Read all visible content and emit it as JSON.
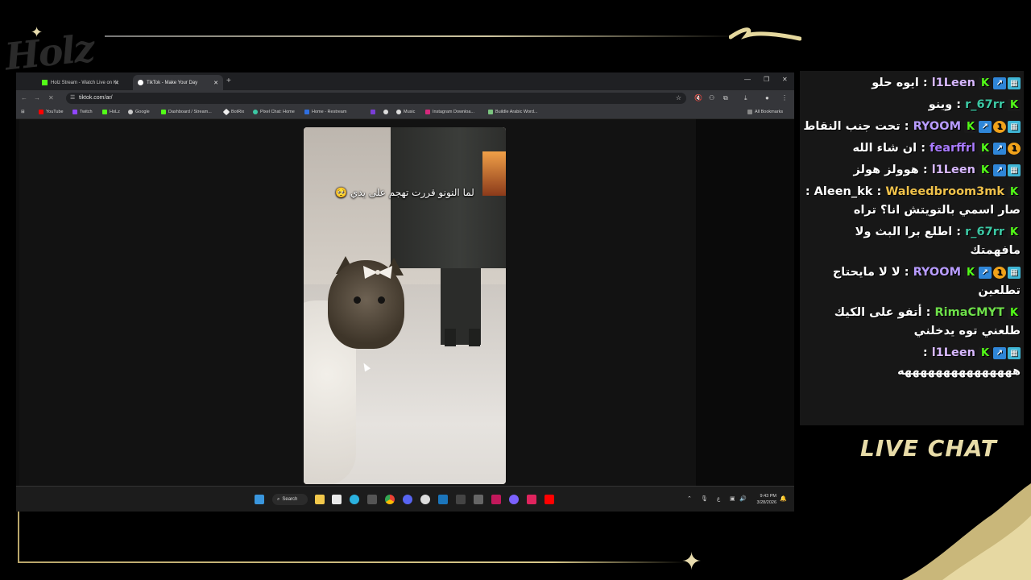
{
  "colors": {
    "gold": "#d8c88a",
    "kick_green": "#53fc18"
  },
  "overlay": {
    "logo_text": "Holz",
    "live_chat_label": "LIVE CHAT"
  },
  "browser": {
    "tabs": [
      {
        "label": "Holz Stream - Watch Live on Ki",
        "icon": "kick-icon"
      },
      {
        "label": "TikTok - Make Your Day",
        "icon": "tiktok-icon"
      }
    ],
    "address": "tiktok.com/ar/",
    "bookmarks": [
      "YouTube",
      "Twitch",
      "HoLz",
      "Google",
      "Dashboard / Stream...",
      "BotRix",
      "Pixel Chat: Home",
      "Home - Restream",
      "Music",
      "Instagram Downloa...",
      "Buildle Arabic Word..."
    ],
    "all_bookmarks": "All Bookmarks",
    "video_caption": "لما النونو قررت تهجم على يدي 🥺"
  },
  "taskbar": {
    "search_label": "Search",
    "time": "9:43 PM",
    "date": "3/28/2026",
    "lang": "ع"
  },
  "chat": {
    "messages": [
      {
        "user": "l1Leen",
        "color": "#d8b8ff",
        "badges": [
          "k",
          "up",
          "g"
        ],
        "text": "ايوه حلو"
      },
      {
        "user": "r_67rr",
        "color": "#3cc8a4",
        "badges": [
          "k"
        ],
        "text": "وينو"
      },
      {
        "user": "RYOOM",
        "color": "#b89cff",
        "badges": [
          "k",
          "up",
          "one",
          "g"
        ],
        "text": "تحت جنب النقاط"
      },
      {
        "user": "fearffrl",
        "color": "#a97bff",
        "badges": [
          "k",
          "up",
          "one"
        ],
        "text": "ان شاء الله"
      },
      {
        "user": "l1Leen",
        "color": "#d8b8ff",
        "badges": [
          "k",
          "up",
          "g"
        ],
        "text": "هوولز هولز"
      },
      {
        "user": "Waleedbroom3mk",
        "color": "#f0c24b",
        "badges": [
          "k"
        ],
        "text": "Aleen_kk : صار اسمي بالتويتش انا؟ تراه"
      },
      {
        "user": "r_67rr",
        "color": "#3cc8a4",
        "badges": [
          "k"
        ],
        "text": "اطلع برا البث ولا مافهمتك"
      },
      {
        "user": "RYOOM",
        "color": "#b89cff",
        "badges": [
          "k",
          "up",
          "one",
          "g"
        ],
        "text": "لا لا مايحتاج تطلعين"
      },
      {
        "user": "RimaCMYT",
        "color": "#6ee04a",
        "badges": [
          "k"
        ],
        "text": "أتفو على الكيك طلعني توه يدخلني"
      },
      {
        "user": "l1Leen",
        "color": "#d8b8ff",
        "badges": [
          "k",
          "up",
          "g"
        ],
        "text": "هههههههههههههههه"
      }
    ]
  }
}
